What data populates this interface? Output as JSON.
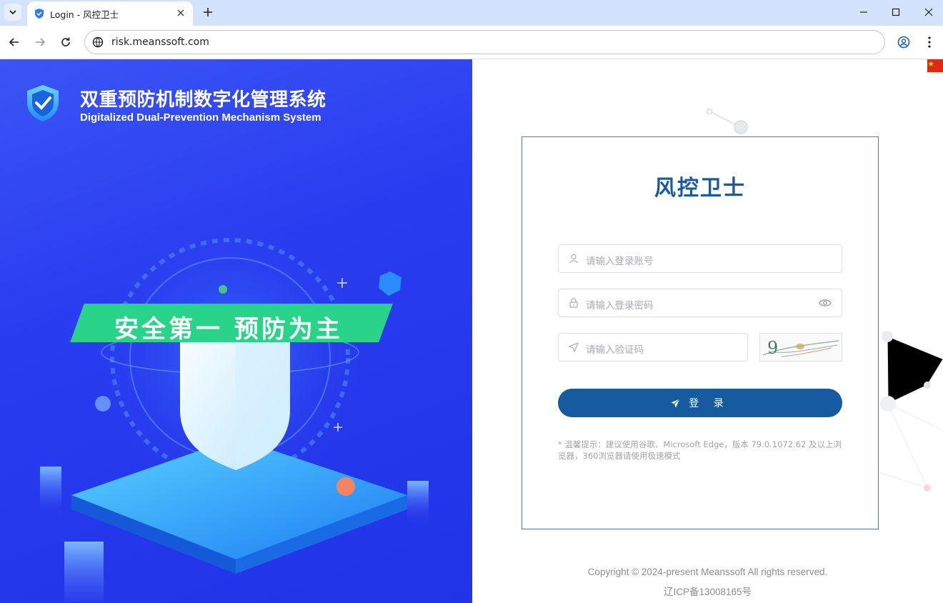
{
  "browser": {
    "tab_title": "Login - 风控卫士",
    "url": "risk.meanssoft.com"
  },
  "brand": {
    "title_cn": "双重预防机制数字化管理系统",
    "title_en": "Digitalized Dual-Prevention Mechanism System"
  },
  "hero": {
    "slogan": "安全第一 预防为主"
  },
  "login": {
    "title": "风控卫士",
    "account_placeholder": "请输入登录账号",
    "password_placeholder": "请输入登录密码",
    "captcha_placeholder": "请输入验证码",
    "captcha_text": "9",
    "submit_label": "登 录",
    "tip": "* 温馨提示：建议使用谷歌、Microsoft Edge，版本 79.0.1072.62 及以上浏览器，360浏览器请使用极速模式"
  },
  "footer": {
    "copyright": "Copyright © 2024-present Meanssoft All rights reserved.",
    "icp": "辽ICP备13008165号"
  },
  "colors": {
    "primary": "#165a9f",
    "left_panel": "#2a3cf0",
    "slogan_bg": "#2ad38a",
    "card_border": "#4a7cb2"
  }
}
